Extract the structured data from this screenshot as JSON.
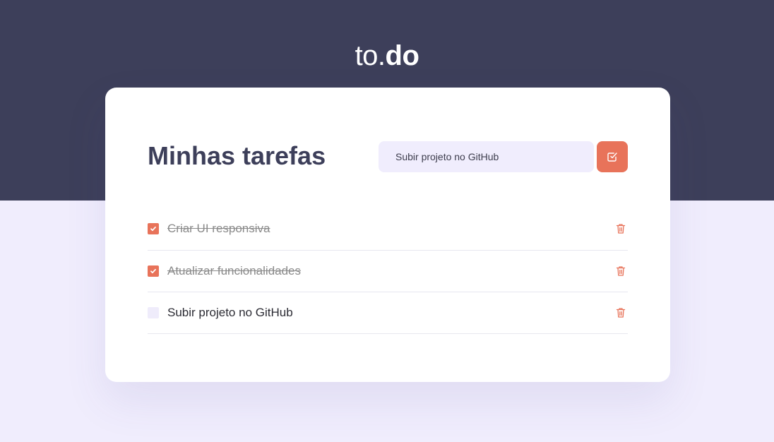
{
  "header": {
    "logo_light": "to.",
    "logo_bold": "do"
  },
  "card": {
    "title": "Minhas tarefas",
    "new_task_value": "Subir projeto no GitHub"
  },
  "tasks": [
    {
      "text": "Criar UI responsiva",
      "done": true
    },
    {
      "text": "Atualizar funcionalidades",
      "done": true
    },
    {
      "text": "Subir projeto no GitHub",
      "done": false
    }
  ],
  "colors": {
    "header_bg": "#3D3F5A",
    "page_bg": "#F0EDFD",
    "accent": "#E8735A",
    "title": "#3D3F5A"
  },
  "icons": {
    "add_button": "check-square-icon",
    "task_checked": "check-icon",
    "task_delete": "trash-icon"
  }
}
